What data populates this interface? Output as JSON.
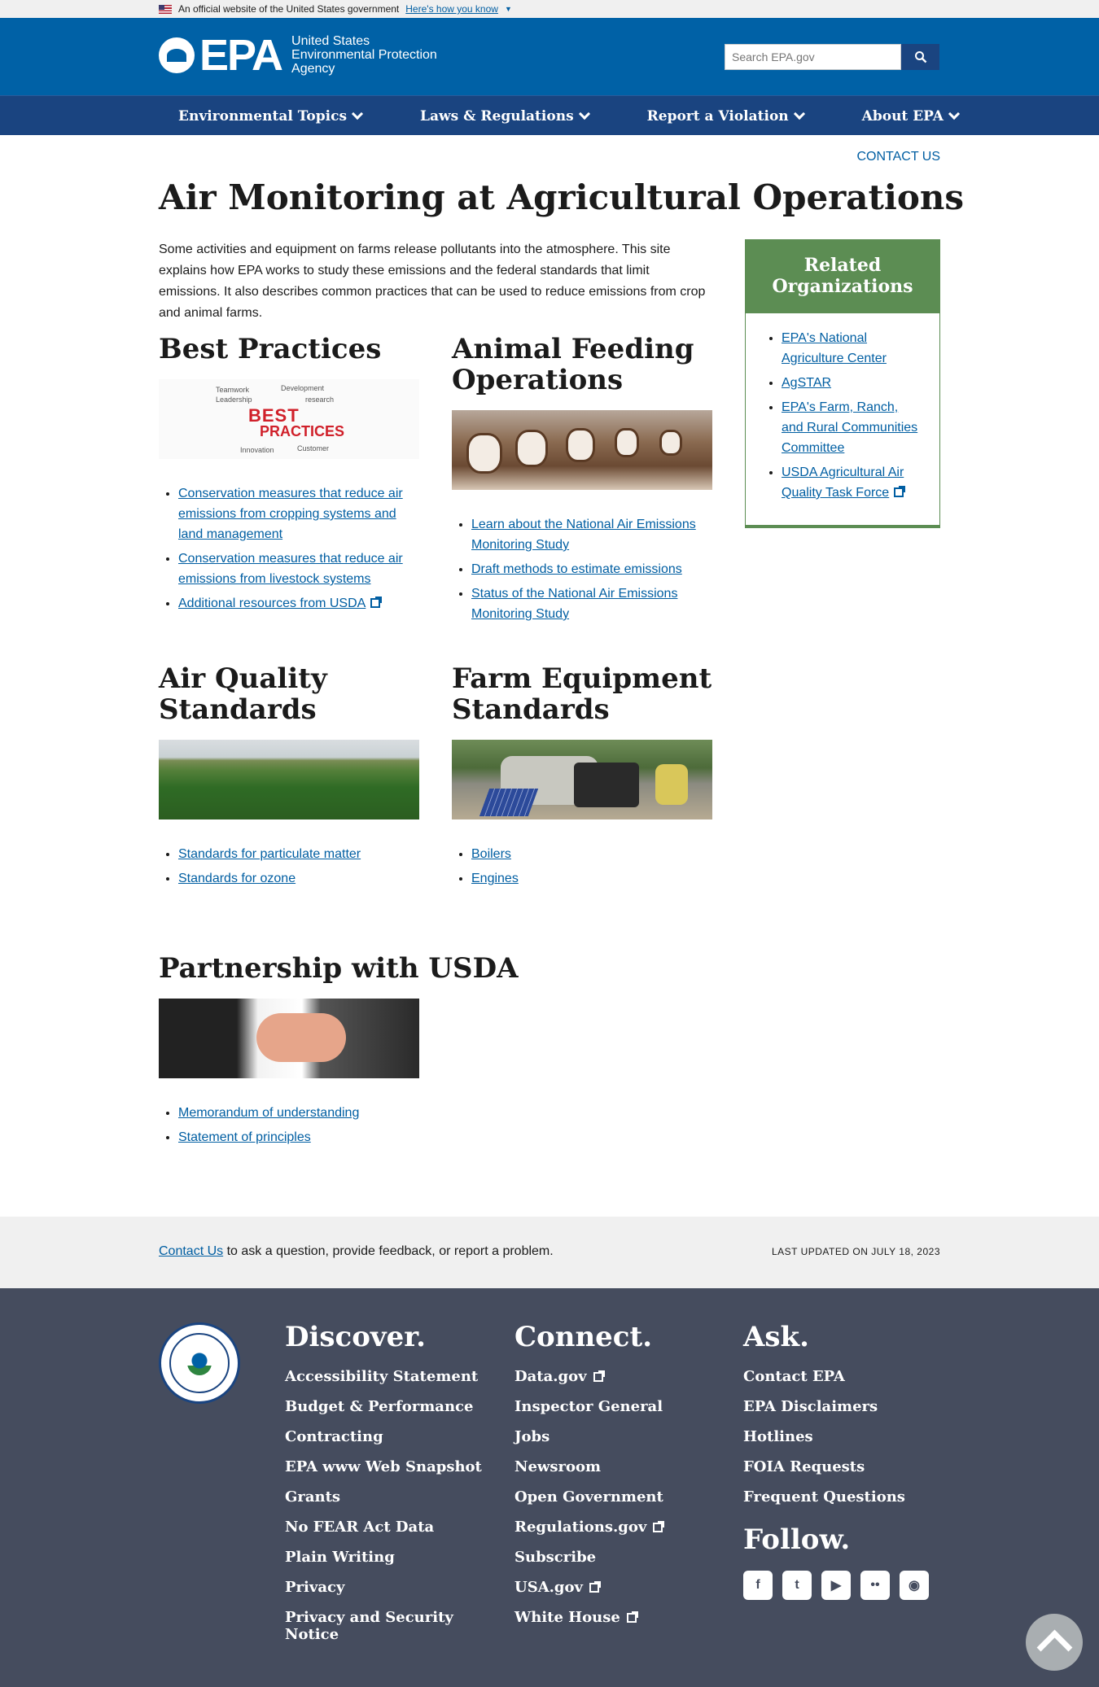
{
  "banner": {
    "text": "An official website of the United States government",
    "link": "Here's how you know"
  },
  "header": {
    "logo": "EPA",
    "agency_line1": "United States",
    "agency_line2": "Environmental Protection",
    "agency_line3": "Agency",
    "search_placeholder": "Search EPA.gov"
  },
  "nav": {
    "items": [
      "Environmental Topics",
      "Laws & Regulations",
      "Report a Violation",
      "About EPA"
    ]
  },
  "contact_top": "CONTACT US",
  "page_title": "Air Monitoring at Agricultural Operations",
  "intro": "Some activities and equipment on farms release pollutants into the atmosphere. This site explains how EPA works to study these emissions and the federal standards that limit emissions. It also describes common practices that can be used to reduce emissions from crop and animal farms.",
  "best_practices": {
    "title": "Best Practices",
    "img_text": "BEST",
    "img_text2": "PRACTICES",
    "links": [
      "Conservation measures that reduce air emissions from cropping systems and land management",
      "Conservation measures that reduce air emissions from livestock systems",
      "Additional resources from USDA"
    ]
  },
  "animal_feeding": {
    "title": "Animal Feeding Operations",
    "links": [
      "Learn about the National Air Emissions Monitoring Study",
      "Draft methods to estimate emissions",
      "Status of the National Air Emissions Monitoring Study"
    ]
  },
  "air_quality": {
    "title": "Air Quality Standards",
    "links": [
      "Standards for particulate matter",
      "Standards for ozone"
    ]
  },
  "farm_equipment": {
    "title": "Farm Equipment Standards",
    "links": [
      "Boilers",
      "Engines"
    ]
  },
  "usda": {
    "title": "Partnership with USDA",
    "links": [
      "Memorandum of understanding",
      "Statement of principles"
    ]
  },
  "aside": {
    "title": "Related Organizations",
    "links": [
      "EPA's National Agriculture Center",
      "AgSTAR",
      "EPA's Farm, Ranch, and Rural Communities Committee",
      "USDA Agricultural Air Quality Task Force"
    ]
  },
  "last_updated": {
    "contact_link": "Contact Us",
    "contact_text": " to ask a question, provide feedback, or report a problem.",
    "date": "LAST UPDATED ON JULY 18, 2023"
  },
  "footer": {
    "discover": {
      "title": "Discover.",
      "items": [
        "Accessibility Statement",
        "Budget & Performance",
        "Contracting",
        "EPA www Web Snapshot",
        "Grants",
        "No FEAR Act Data",
        "Plain Writing",
        "Privacy",
        "Privacy and Security Notice"
      ]
    },
    "connect": {
      "title": "Connect.",
      "items": [
        "Data.gov",
        "Inspector General",
        "Jobs",
        "Newsroom",
        "Open Government",
        "Regulations.gov",
        "Subscribe",
        "USA.gov",
        "White House"
      ]
    },
    "ask": {
      "title": "Ask.",
      "items": [
        "Contact EPA",
        "EPA Disclaimers",
        "Hotlines",
        "FOIA Requests",
        "Frequent Questions"
      ]
    },
    "follow": {
      "title": "Follow.",
      "icons": [
        "facebook-icon",
        "twitter-icon",
        "youtube-icon",
        "flickr-icon",
        "instagram-icon"
      ]
    }
  },
  "colors": {
    "header": "#0061a6",
    "nav": "#1a4480",
    "aside": "#5c8d53",
    "footer": "#454c5e",
    "link": "#005ea2"
  }
}
